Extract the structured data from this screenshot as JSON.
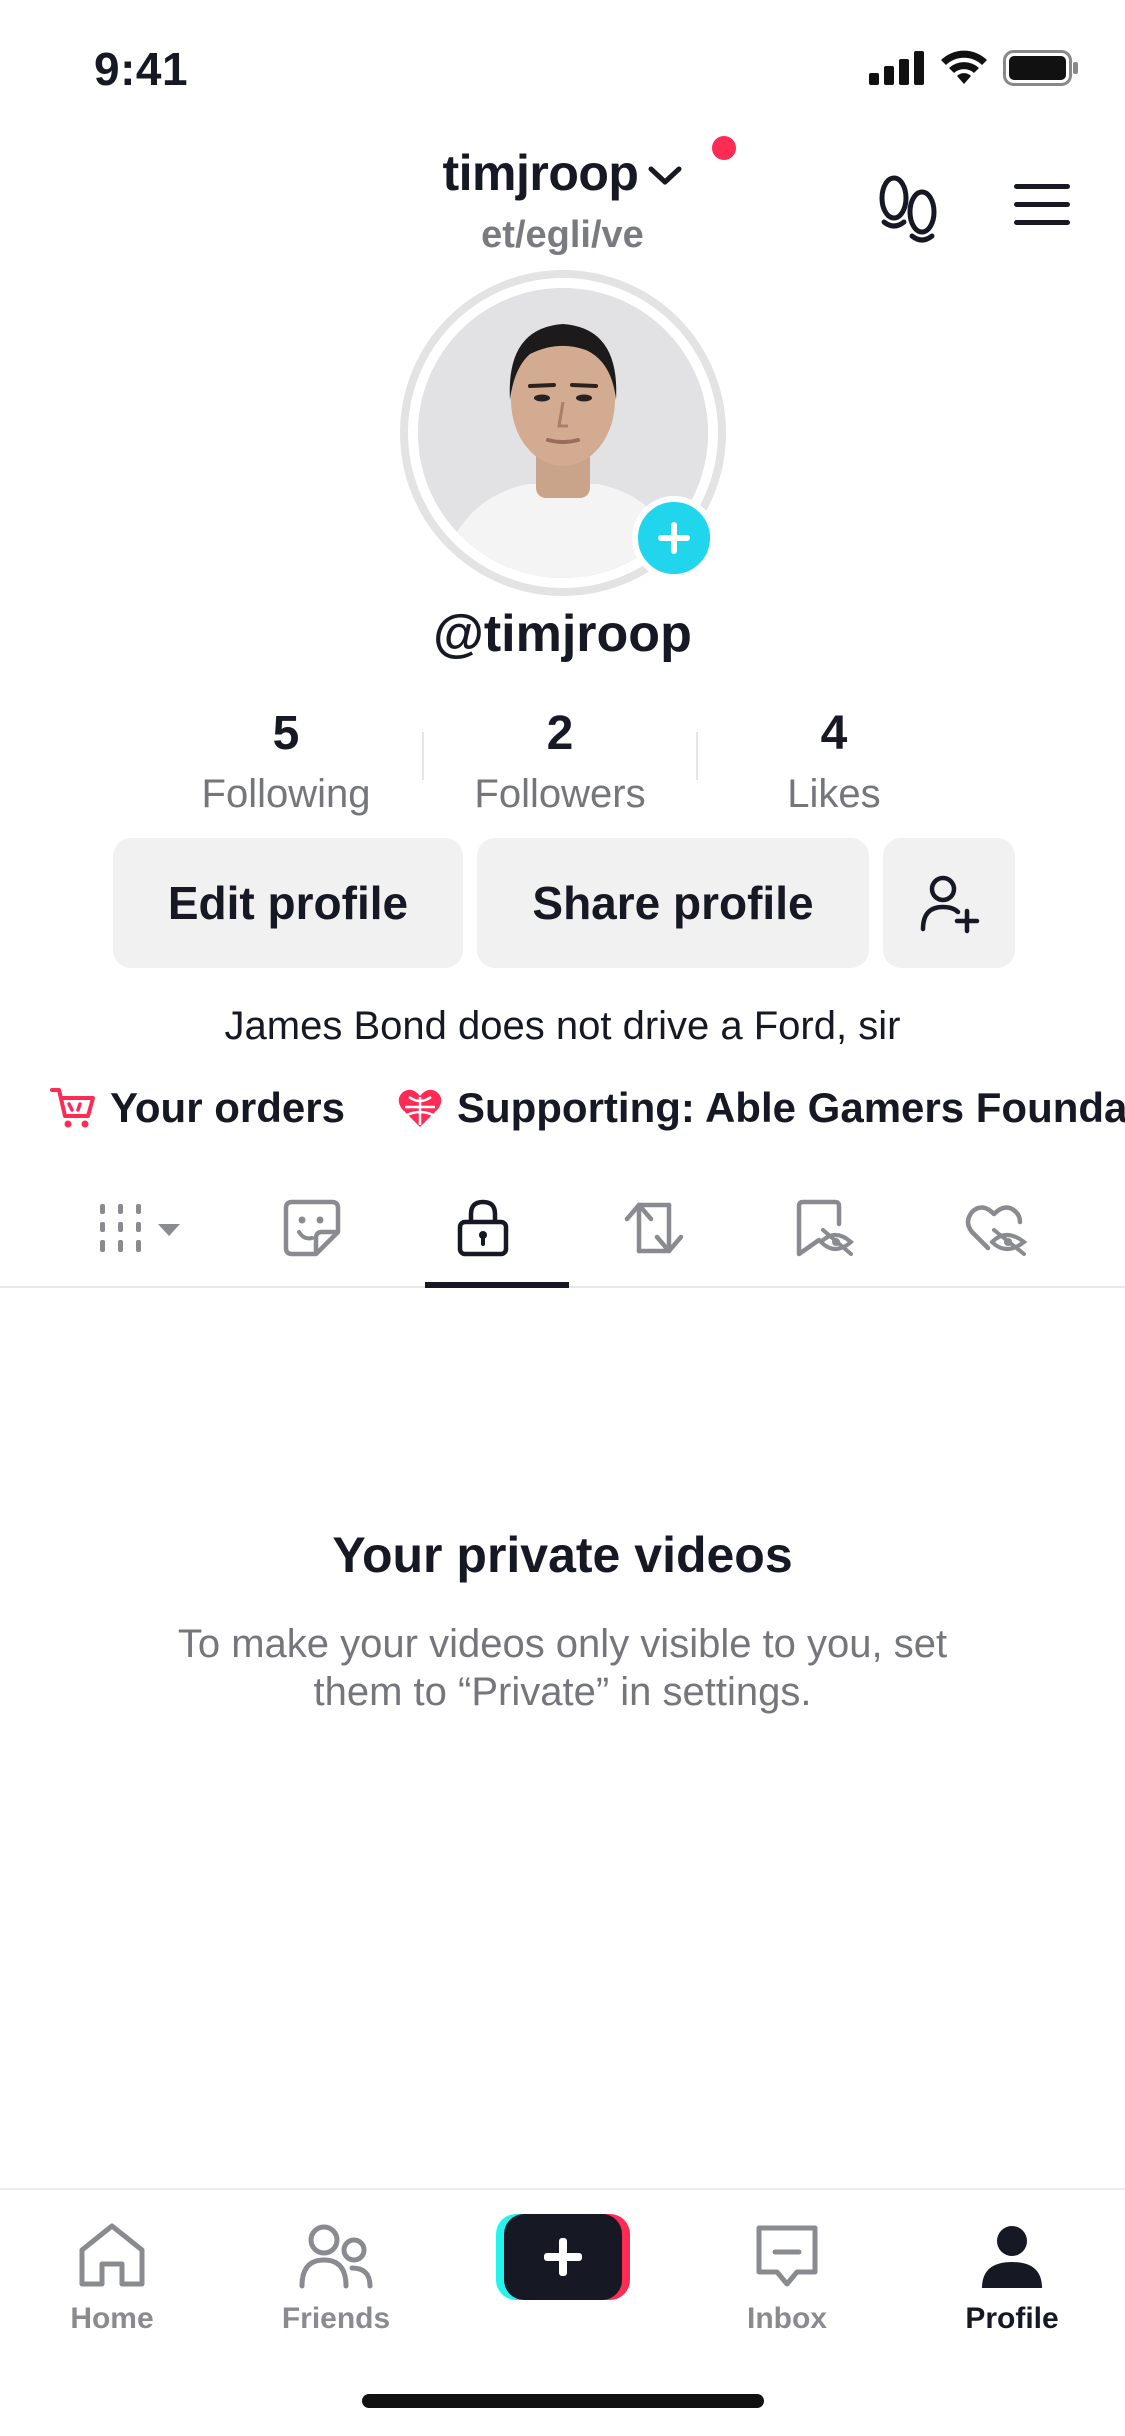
{
  "status_bar": {
    "time": "9:41"
  },
  "header": {
    "username": "timjroop",
    "pronouns": "et/egli/ve"
  },
  "profile": {
    "handle": "@timjroop",
    "stats": [
      {
        "value": "5",
        "label": "Following"
      },
      {
        "value": "2",
        "label": "Followers"
      },
      {
        "value": "4",
        "label": "Likes"
      }
    ],
    "buttons": {
      "edit": "Edit profile",
      "share": "Share profile"
    },
    "bio": "James Bond does not drive a Ford, sir",
    "links": {
      "orders": "Your orders",
      "supporting": "Supporting: Able Gamers Foundati"
    }
  },
  "tabs": [
    {
      "icon": "grid-icon",
      "active": false
    },
    {
      "icon": "sticker-icon",
      "active": false
    },
    {
      "icon": "lock-icon",
      "active": true
    },
    {
      "icon": "repost-icon",
      "active": false
    },
    {
      "icon": "favorites-hidden-icon",
      "active": false
    },
    {
      "icon": "liked-hidden-icon",
      "active": false
    }
  ],
  "empty_state": {
    "title": "Your private videos",
    "description": "To make your videos only visible to you, set them to “Private” in settings."
  },
  "bottom_nav": {
    "home": "Home",
    "friends": "Friends",
    "inbox": "Inbox",
    "profile": "Profile"
  },
  "colors": {
    "accent_red": "#fe2c55",
    "accent_cyan": "#20d5ec",
    "text_primary": "#161823",
    "text_secondary": "#75767b"
  }
}
